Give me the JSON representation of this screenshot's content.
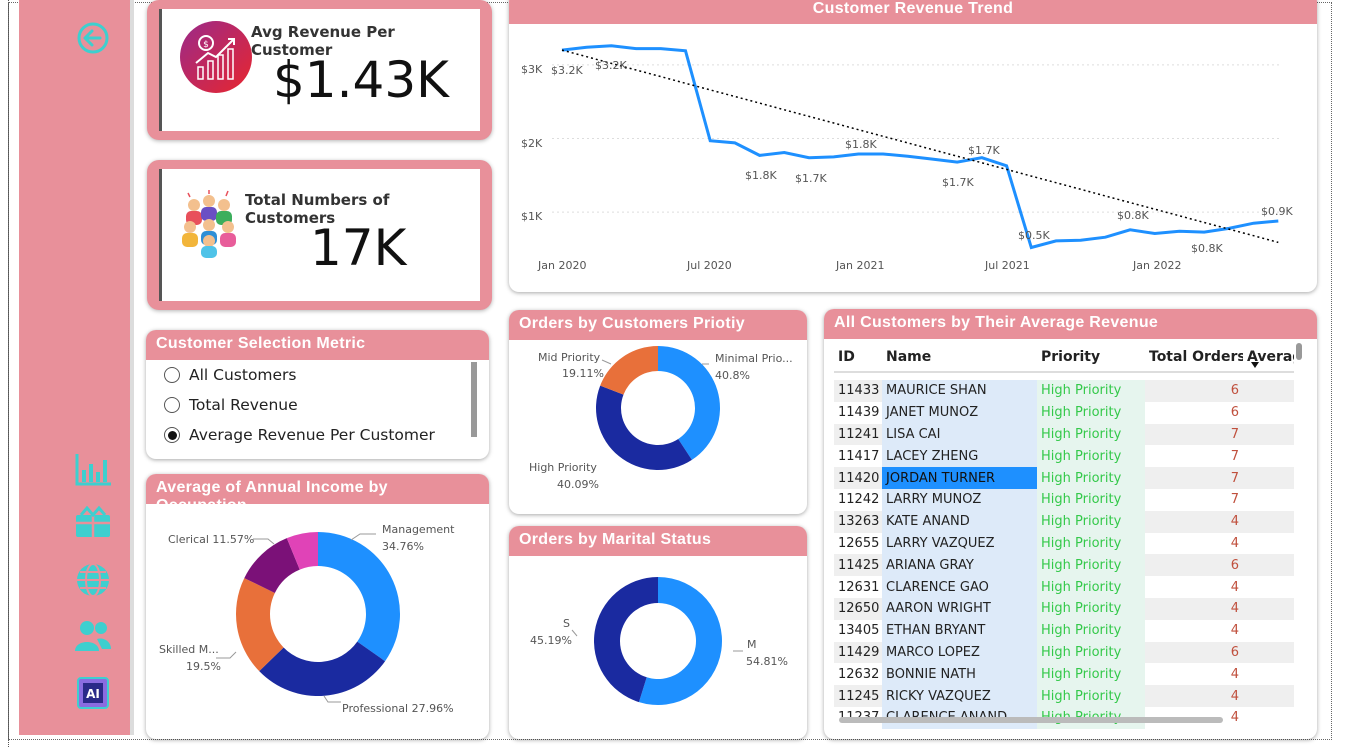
{
  "nav": {
    "icons": [
      "back-arrow-icon",
      "bar-chart-icon",
      "boxes-icon",
      "globe-icon",
      "users-icon",
      "ai-chip-icon"
    ],
    "accent": "#3ecfcf"
  },
  "kpi_revenue": {
    "title": "Avg Revenue Per Customer",
    "value": "$1.43K"
  },
  "kpi_customers": {
    "title": "Total Numbers of Customers",
    "value": "17K"
  },
  "trend": {
    "title": "Customer Revenue Trend",
    "y_ticks": [
      "$3K",
      "$2K",
      "$1K"
    ],
    "x_ticks": [
      "Jan 2020",
      "Jul 2020",
      "Jan 2021",
      "Jul 2021",
      "Jan 2022"
    ],
    "labels": [
      "$3.2K",
      "$3.2K",
      "$1.8K",
      "$1.7K",
      "$1.8K",
      "$1.7K",
      "$1.7K",
      "$0.5K",
      "$0.8K",
      "$0.8K",
      "$0.9K"
    ]
  },
  "selection": {
    "title": "Customer Selection Metric",
    "options": [
      "All Customers",
      "Total Revenue",
      "Average Revenue Per Customer"
    ],
    "selected": "Average Revenue Per Customer"
  },
  "occupation": {
    "title": "Average of Annual Income by Occupation",
    "labels": [
      "Management",
      "34.76%",
      "Professional 27.96%",
      "Skilled M...",
      "19.5%",
      "Clerical 11.57%"
    ]
  },
  "priority": {
    "title": "Orders by Customers Priotiy",
    "labels": [
      "Mid Priority",
      "19.11%",
      "Minimal Prio...",
      "40.8%",
      "High Priority",
      "40.09%"
    ]
  },
  "marital": {
    "title": "Orders by Marital Status",
    "labels": [
      "S",
      "45.19%",
      "M",
      "54.81%"
    ]
  },
  "customers_table": {
    "title": "All Customers by Their Average Revenue",
    "columns": [
      "ID",
      "Name",
      "Priority",
      "Total Orders",
      "Averag"
    ],
    "rows": [
      [
        "11433",
        "MAURICE SHAN",
        "High Priority",
        "6"
      ],
      [
        "11439",
        "JANET MUNOZ",
        "High Priority",
        "6"
      ],
      [
        "11241",
        "LISA CAI",
        "High Priority",
        "7"
      ],
      [
        "11417",
        "LACEY ZHENG",
        "High Priority",
        "7"
      ],
      [
        "11420",
        "JORDAN TURNER",
        "High Priority",
        "7"
      ],
      [
        "11242",
        "LARRY MUNOZ",
        "High Priority",
        "7"
      ],
      [
        "13263",
        "KATE ANAND",
        "High Priority",
        "4"
      ],
      [
        "12655",
        "LARRY VAZQUEZ",
        "High Priority",
        "4"
      ],
      [
        "11425",
        "ARIANA GRAY",
        "High Priority",
        "6"
      ],
      [
        "12631",
        "CLARENCE GAO",
        "High Priority",
        "4"
      ],
      [
        "12650",
        "AARON WRIGHT",
        "High Priority",
        "4"
      ],
      [
        "13405",
        "ETHAN BRYANT",
        "High Priority",
        "4"
      ],
      [
        "11429",
        "MARCO LOPEZ",
        "High Priority",
        "6"
      ],
      [
        "12632",
        "BONNIE NATH",
        "High Priority",
        "4"
      ],
      [
        "11245",
        "RICKY VAZQUEZ",
        "High Priority",
        "4"
      ],
      [
        "11237",
        "CLARENCE ANAND",
        "High Priority",
        "4"
      ]
    ],
    "selected_name": "JORDAN TURNER"
  },
  "chart_data": [
    {
      "type": "line",
      "title": "Customer Revenue Trend",
      "xlabel": "",
      "ylabel": "",
      "x": [
        "2020-01",
        "2020-02",
        "2020-03",
        "2020-04",
        "2020-05",
        "2020-06",
        "2020-07",
        "2020-08",
        "2020-09",
        "2020-10",
        "2020-11",
        "2020-12",
        "2021-01",
        "2021-02",
        "2021-03",
        "2021-04",
        "2021-05",
        "2021-06",
        "2021-07",
        "2021-08",
        "2021-09",
        "2021-10",
        "2021-11",
        "2021-12",
        "2022-01",
        "2022-02",
        "2022-03",
        "2022-04",
        "2022-05",
        "2022-06"
      ],
      "series": [
        {
          "values": [
            3.2,
            3.24,
            3.26,
            3.22,
            3.22,
            3.19,
            1.97,
            1.94,
            1.77,
            1.81,
            1.74,
            1.75,
            1.79,
            1.79,
            1.76,
            1.72,
            1.68,
            1.74,
            1.63,
            0.52,
            0.61,
            0.62,
            0.66,
            0.76,
            0.71,
            0.74,
            0.73,
            0.78,
            0.85,
            0.88
          ]
        },
        {
          "values": [
            3.2,
            3.11,
            3.02,
            2.93,
            2.84,
            2.75,
            2.66,
            2.57,
            2.48,
            2.39,
            2.3,
            2.21,
            2.12,
            2.03,
            1.94,
            1.85,
            1.76,
            1.67,
            1.58,
            1.49,
            1.4,
            1.31,
            1.22,
            1.13,
            1.04,
            0.95,
            0.86,
            0.77,
            0.68,
            0.59
          ]
        }
      ],
      "ylim": [
        0.5,
        3.5
      ],
      "y_ticks": [
        1,
        2,
        3
      ],
      "grid": true,
      "line_colors": [
        "#1e90ff",
        "#000000"
      ]
    },
    {
      "type": "pie",
      "title": "Average of Annual Income by Occupation",
      "labels": [
        "Management",
        "Professional",
        "Skilled M...",
        "Clerical",
        ""
      ],
      "values": [
        34.76,
        27.96,
        19.5,
        11.57,
        6.21
      ],
      "colors": [
        "#1e90ff",
        "#1a2aa0",
        "#e8703a",
        "#7b1178",
        "#e043b7"
      ]
    },
    {
      "type": "pie",
      "title": "Orders by Customers Priotiy",
      "labels": [
        "Minimal Prio...",
        "High Priority",
        "Mid Priority"
      ],
      "values": [
        40.8,
        40.09,
        19.11
      ],
      "colors": [
        "#1e90ff",
        "#1a2aa0",
        "#e8703a"
      ]
    },
    {
      "type": "pie",
      "title": "Orders by Marital Status",
      "labels": [
        "M",
        "S"
      ],
      "values": [
        54.81,
        45.19
      ],
      "colors": [
        "#1e90ff",
        "#1a2aa0"
      ]
    }
  ]
}
